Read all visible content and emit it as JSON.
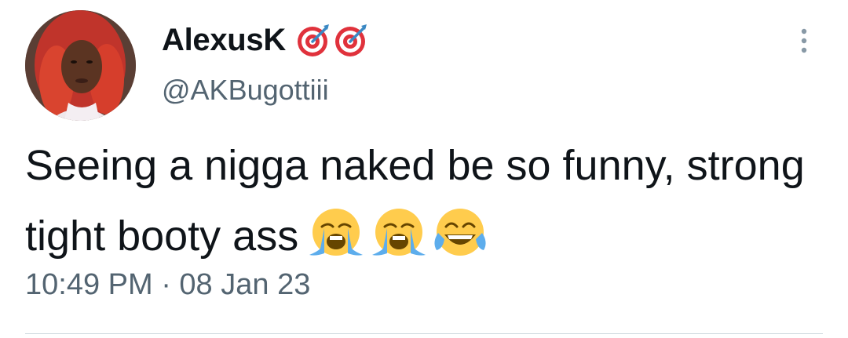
{
  "author": {
    "display_name": "AlexusK",
    "handle": "@AKBugottiii",
    "badges": [
      "bullseye-emoji",
      "bullseye-emoji"
    ]
  },
  "tweet": {
    "text": "Seeing a nigga naked be so funny, strong tight booty ass",
    "emojis": [
      "loudly-crying-face-emoji",
      "loudly-crying-face-emoji",
      "face-with-tears-of-joy-emoji"
    ],
    "timestamp": "10:49 PM · 08 Jan 23"
  },
  "icons": {
    "more": "more-vertical-icon"
  },
  "colors": {
    "text_primary": "#0f1419",
    "text_secondary": "#536471",
    "divider": "#cfd9de",
    "background": "#ffffff"
  }
}
